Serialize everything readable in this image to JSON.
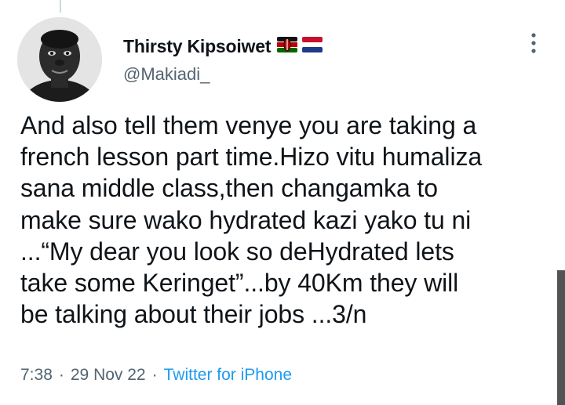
{
  "user": {
    "display_name": "Thirsty Kipsoiwet",
    "handle": "@Makiadi_",
    "flags": [
      "kenya-flag-icon",
      "netherlands-flag-icon"
    ]
  },
  "tweet": {
    "lines": [
      "And also tell them venye you are taking a",
      "french lesson part time.Hizo vitu humaliza",
      "sana middle class,then changamka to",
      "make sure wako hydrated kazi yako tu ni",
      "...“My dear you look so deHydrated lets",
      "take some Keringet”...by 40Km they will",
      "be talking about their jobs ...3/n"
    ]
  },
  "meta": {
    "time": "7:38",
    "separator": "·",
    "date": "29 Nov 22",
    "source": "Twitter for iPhone"
  },
  "colors": {
    "text": "#0f1419",
    "secondary": "#536471",
    "link": "#1d9bf0"
  }
}
